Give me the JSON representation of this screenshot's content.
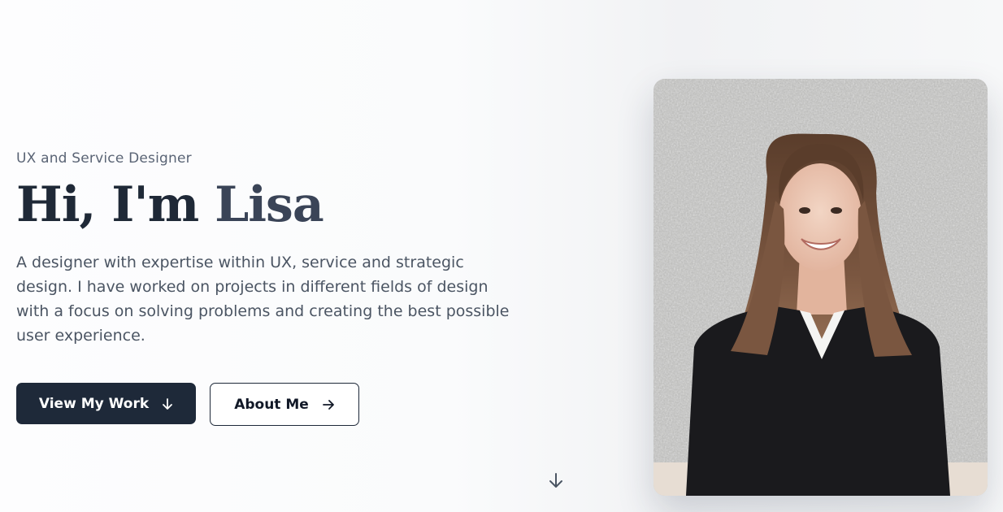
{
  "hero": {
    "subtitle": "UX and Service Designer",
    "greeting": "Hi, I'm",
    "name": "Lisa",
    "description": "A designer with expertise within UX, service and strategic design. I have worked on projects in different fields of design with a focus on solving problems and creating the best possible user experience."
  },
  "buttons": {
    "primary": {
      "label": "View My Work",
      "icon": "arrow-down-icon"
    },
    "secondary": {
      "label": "About Me",
      "icon": "arrow-right-icon"
    }
  },
  "scroll_cue": {
    "icon": "arrow-down-icon"
  },
  "portrait": {
    "subject": "portrait photo"
  },
  "colors": {
    "primary_button": "#1e2939",
    "heading": "#1f2937",
    "subtitle": "#5a6475",
    "body_text": "#4b5563"
  }
}
